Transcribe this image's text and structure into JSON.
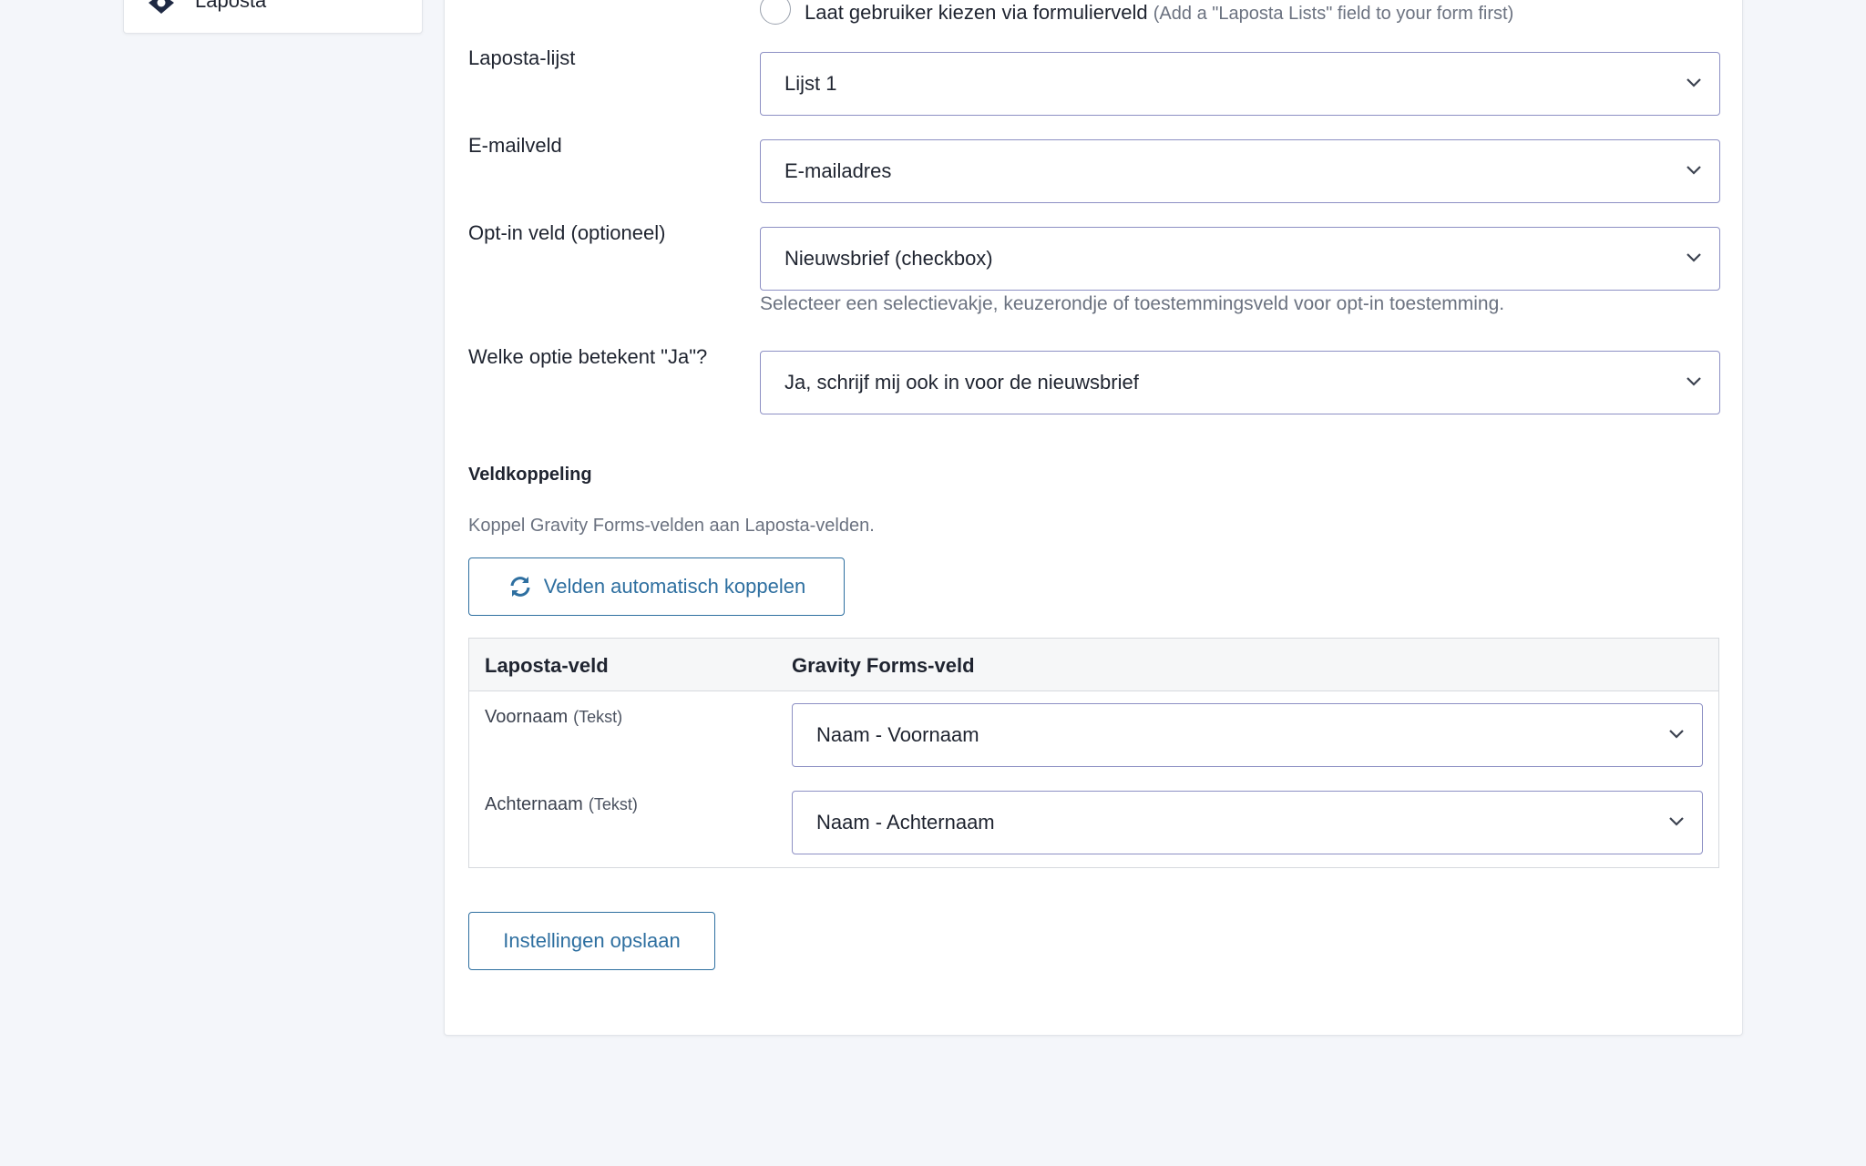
{
  "sidebar": {
    "label": "Laposta"
  },
  "form": {
    "radio_option": {
      "label": "Laat gebruiker kiezen via formulierveld",
      "hint": "(Add a \"Laposta Lists\" field to your form first)"
    },
    "list_field": {
      "label": "Laposta-lijst",
      "value": "Lijst 1"
    },
    "email_field": {
      "label": "E-mailveld",
      "value": "E-mailadres"
    },
    "optin_field": {
      "label": "Opt-in veld (optioneel)",
      "value": "Nieuwsbrief (checkbox)",
      "help": "Selecteer een selectievakje, keuzerondje of toestemmingsveld voor opt-in toestemming."
    },
    "yes_option_field": {
      "label": "Welke optie betekent \"Ja\"?",
      "value": "Ja, schrijf mij ook in voor de nieuwsbrief"
    }
  },
  "mapping": {
    "title": "Veldkoppeling",
    "description": "Koppel Gravity Forms-velden aan Laposta-velden.",
    "auto_button": "Velden automatisch koppelen",
    "columns": [
      "Laposta-veld",
      "Gravity Forms-veld"
    ],
    "rows": [
      {
        "field": "Voornaam",
        "type": "(Tekst)",
        "value": "Naam - Voornaam"
      },
      {
        "field": "Achternaam",
        "type": "(Tekst)",
        "value": "Naam - Achternaam"
      }
    ]
  },
  "save_button": "Instellingen opslaan",
  "colors": {
    "accent": "#2e6fa0",
    "select_border": "#8d90c4",
    "background": "#f4f6fa"
  },
  "icons": {
    "logo": "laposta-logo-icon",
    "sync": "sync-icon",
    "chevron": "chevron-down-icon"
  }
}
